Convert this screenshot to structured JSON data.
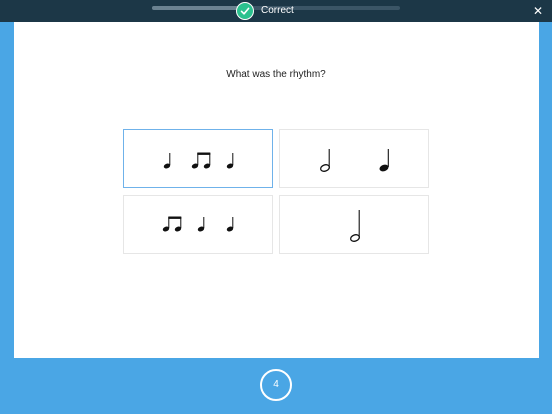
{
  "header": {
    "status_label": "Correct",
    "progress_fraction": 0.37,
    "close_label": "✕"
  },
  "question": {
    "text": "What was the rhythm?"
  },
  "options": [
    {
      "name": "quarter-two-eighths-quarter",
      "selected": true
    },
    {
      "name": "half-quarter",
      "selected": false
    },
    {
      "name": "two-eighths-quarter-quarter",
      "selected": false
    },
    {
      "name": "half",
      "selected": false
    }
  ],
  "timer": {
    "value": "4"
  },
  "colors": {
    "topbar": "#1c3747",
    "background": "#4aa6e5",
    "correct_green": "#2bc18e",
    "selected_border": "#6fb2ea"
  }
}
